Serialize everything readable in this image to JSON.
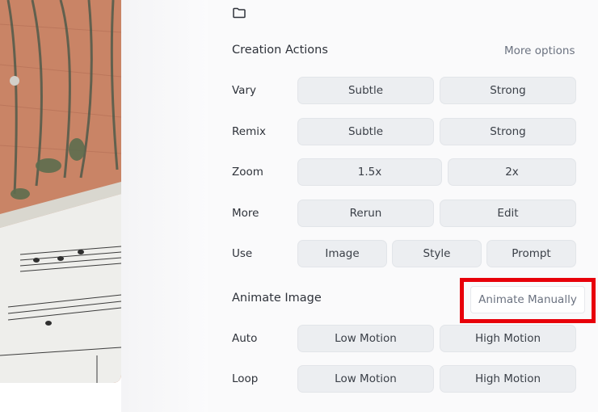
{
  "creation_actions": {
    "title": "Creation Actions",
    "more_options": "More options",
    "rows": {
      "vary": {
        "label": "Vary",
        "buttons": [
          "Subtle",
          "Strong"
        ]
      },
      "remix": {
        "label": "Remix",
        "buttons": [
          "Subtle",
          "Strong"
        ]
      },
      "zoom": {
        "label": "Zoom",
        "buttons": [
          "1.5x",
          "2x"
        ]
      },
      "more": {
        "label": "More",
        "buttons": [
          "Rerun",
          "Edit"
        ]
      },
      "use": {
        "label": "Use",
        "buttons": [
          "Image",
          "Style",
          "Prompt"
        ]
      }
    }
  },
  "animate_image": {
    "title": "Animate Image",
    "animate_manually": "Animate Manually",
    "highlight_color": "#e8000a",
    "rows": {
      "auto": {
        "label": "Auto",
        "buttons": [
          "Low Motion",
          "High Motion"
        ]
      },
      "loop": {
        "label": "Loop",
        "buttons": [
          "Low Motion",
          "High Motion"
        ]
      }
    }
  }
}
